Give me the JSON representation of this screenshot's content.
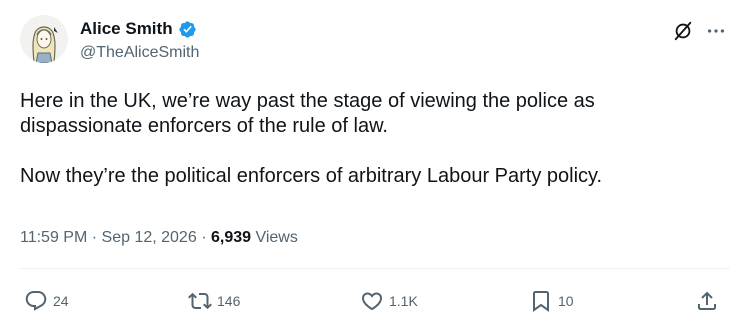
{
  "author": {
    "name": "Alice Smith",
    "handle": "@TheAliceSmith",
    "verified": true
  },
  "tweet": {
    "paragraphs": [
      "Here in the UK, we’re way past the stage of viewing the police as dispassionate enforcers of the rule of law.",
      "Now they’re the political enforcers of arbitrary Labour Party policy."
    ],
    "time": "11:59 PM",
    "date": "Sep 12, 2026",
    "views_count": "6,939",
    "views_label": "Views"
  },
  "actions": {
    "replies": "24",
    "reposts": "146",
    "likes": "1.1K",
    "bookmarks": "10"
  },
  "icons": {
    "verified": "verified-badge-icon",
    "grok": "grok-icon",
    "more": "more-icon",
    "reply": "reply-icon",
    "repost": "repost-icon",
    "like": "heart-icon",
    "bookmark": "bookmark-icon",
    "share": "share-icon"
  },
  "colors": {
    "text": "#0f1419",
    "secondary": "#536471",
    "verified": "#1d9bf0",
    "divider": "#eff3f4"
  }
}
